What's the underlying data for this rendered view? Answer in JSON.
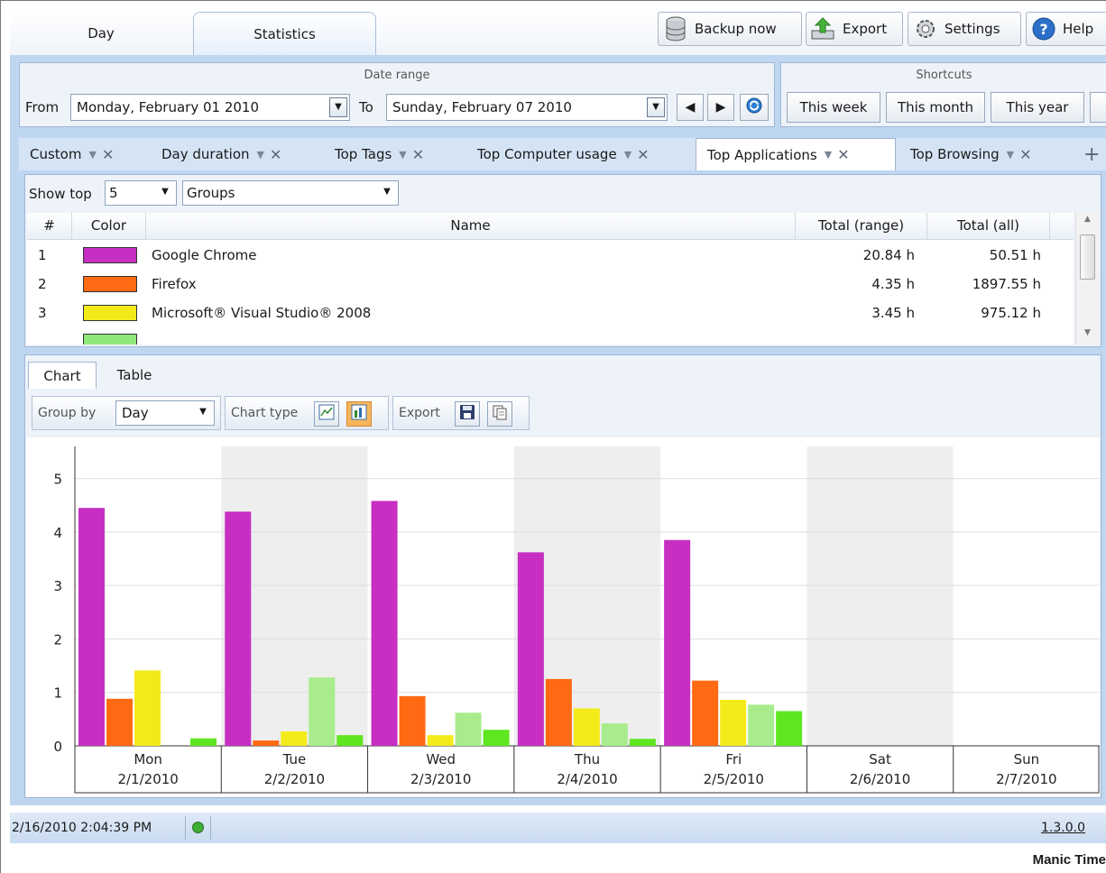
{
  "main_tabs": [
    {
      "label": "Day"
    },
    {
      "label": "Statistics"
    }
  ],
  "toolbar": {
    "backup": "Backup now",
    "export": "Export",
    "settings": "Settings",
    "help": "Help"
  },
  "date_range": {
    "title": "Date range",
    "from_label": "From",
    "from_value": "Monday, February 01 2010",
    "to_label": "To",
    "to_value": "Sunday, February 07 2010"
  },
  "shortcuts": {
    "title": "Shortcuts",
    "this_week": "This week",
    "this_month": "This month",
    "this_year": "This year"
  },
  "report_tabs": [
    {
      "label": "Custom"
    },
    {
      "label": "Day duration"
    },
    {
      "label": "Top Tags"
    },
    {
      "label": "Top Computer usage"
    },
    {
      "label": "Top Applications"
    },
    {
      "label": "Top Browsing"
    }
  ],
  "filters": {
    "show_top_label": "Show top",
    "show_top_value": "5",
    "group_value": "Groups"
  },
  "table": {
    "columns": [
      "#",
      "Color",
      "Name",
      "Total (range)",
      "Total (all)"
    ],
    "rows": [
      {
        "num": "1",
        "color": "#c62fc2",
        "name": "Google Chrome",
        "range": "20.84 h",
        "all": "50.51 h"
      },
      {
        "num": "2",
        "color": "#ff6a13",
        "name": "Firefox",
        "range": "4.35 h",
        "all": "1897.55 h"
      },
      {
        "num": "3",
        "color": "#f4ea1a",
        "name": "Microsoft® Visual Studio® 2008",
        "range": "3.45 h",
        "all": "975.12 h"
      },
      {
        "num": "4",
        "color": "#8ee87a",
        "name": "",
        "range": "",
        "all": ""
      }
    ]
  },
  "chart_tabs": [
    {
      "label": "Chart"
    },
    {
      "label": "Table"
    }
  ],
  "chart_toolbar": {
    "group_by_label": "Group by",
    "group_by_value": "Day",
    "chart_type_label": "Chart type",
    "export_label": "Export"
  },
  "chart_data": {
    "type": "bar",
    "categories": [
      "Mon\n2/1/2010",
      "Tue\n2/2/2010",
      "Wed\n2/3/2010",
      "Thu\n2/4/2010",
      "Fri\n2/5/2010",
      "Sat\n2/6/2010",
      "Sun\n2/7/2010"
    ],
    "category_day": [
      "Mon",
      "Tue",
      "Wed",
      "Thu",
      "Fri",
      "Sat",
      "Sun"
    ],
    "category_date": [
      "2/1/2010",
      "2/2/2010",
      "2/3/2010",
      "2/4/2010",
      "2/5/2010",
      "2/6/2010",
      "2/7/2010"
    ],
    "series": [
      {
        "color": "#c62fc2",
        "values": [
          4.45,
          4.38,
          4.58,
          3.62,
          3.85,
          0,
          0
        ]
      },
      {
        "color": "#ff6a13",
        "values": [
          0.88,
          0.1,
          0.93,
          1.25,
          1.22,
          0,
          0
        ]
      },
      {
        "color": "#f4ea1a",
        "values": [
          1.41,
          0.27,
          0.2,
          0.7,
          0.86,
          0,
          0
        ]
      },
      {
        "color": "#a8ec8e",
        "values": [
          0,
          1.28,
          0.62,
          0.42,
          0.77,
          0,
          0
        ]
      },
      {
        "color": "#5ee620",
        "values": [
          0.14,
          0.2,
          0.3,
          0.13,
          0.65,
          0,
          0
        ]
      }
    ],
    "yticks": [
      0,
      1,
      2,
      3,
      4,
      5
    ],
    "ylim": [
      0,
      5.6
    ],
    "band_colors": [
      "#ffffff",
      "#eeeeee"
    ]
  },
  "status": {
    "datetime": "2/16/2010 2:04:39 PM",
    "version": "1.3.0.0",
    "status_color": "#3fae35"
  },
  "brand": "Manic Time"
}
